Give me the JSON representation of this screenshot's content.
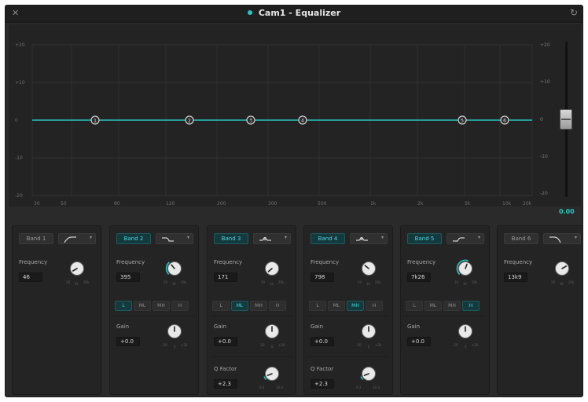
{
  "window": {
    "title": "Cam1 - Equalizer",
    "close_glyph": "✕",
    "reset_glyph": "↻",
    "accent": "#27c4c0"
  },
  "graph": {
    "y_ticks": [
      "+20",
      "+10",
      "0",
      "-10",
      "-20"
    ],
    "x_ticks": [
      "30",
      "50",
      "80",
      "120",
      "200",
      "300",
      "500",
      "1k",
      "2k",
      "5k",
      "10k",
      "20k"
    ],
    "markers": [
      "1",
      "2",
      "3",
      "4",
      "5",
      "6"
    ]
  },
  "fader": {
    "top_label": "+20",
    "mid_top": "+10",
    "zero": "0",
    "mid_bot": "-10",
    "bottom_label": "-20",
    "value": "0.00",
    "level_db": 0
  },
  "band_labels": {
    "frequency": "Frequency",
    "gain": "Gain",
    "q_factor": "Q Factor",
    "range_l": "L",
    "range_ml": "ML",
    "range_mh": "MH",
    "range_h": "H",
    "scale_min": "20",
    "scale_mid": "1k",
    "scale_max": "20k",
    "gain_min": "-20",
    "gain_mid": "0",
    "gain_max": "+20",
    "q_min": "0.3",
    "q_max": "10.3"
  },
  "bands": [
    {
      "name": "Band 1",
      "active": false,
      "shape": "highpass-icon",
      "frequency": "46"
    },
    {
      "name": "Band 2",
      "active": true,
      "shape": "lowshelf-icon",
      "frequency": "395",
      "range": "L",
      "gain": "+0.0"
    },
    {
      "name": "Band 3",
      "active": true,
      "shape": "bell-icon",
      "frequency": "171",
      "range": "ML",
      "gain": "+0.0",
      "q": "+2.3"
    },
    {
      "name": "Band 4",
      "active": true,
      "shape": "bell-icon",
      "frequency": "798",
      "range": "MH",
      "gain": "+0.0",
      "q": "+2.3"
    },
    {
      "name": "Band 5",
      "active": true,
      "shape": "highshelf-icon",
      "frequency": "7k26",
      "range": "H",
      "gain": "+0.0"
    },
    {
      "name": "Band 6",
      "active": false,
      "shape": "lowpass-icon",
      "frequency": "13k9"
    }
  ]
}
